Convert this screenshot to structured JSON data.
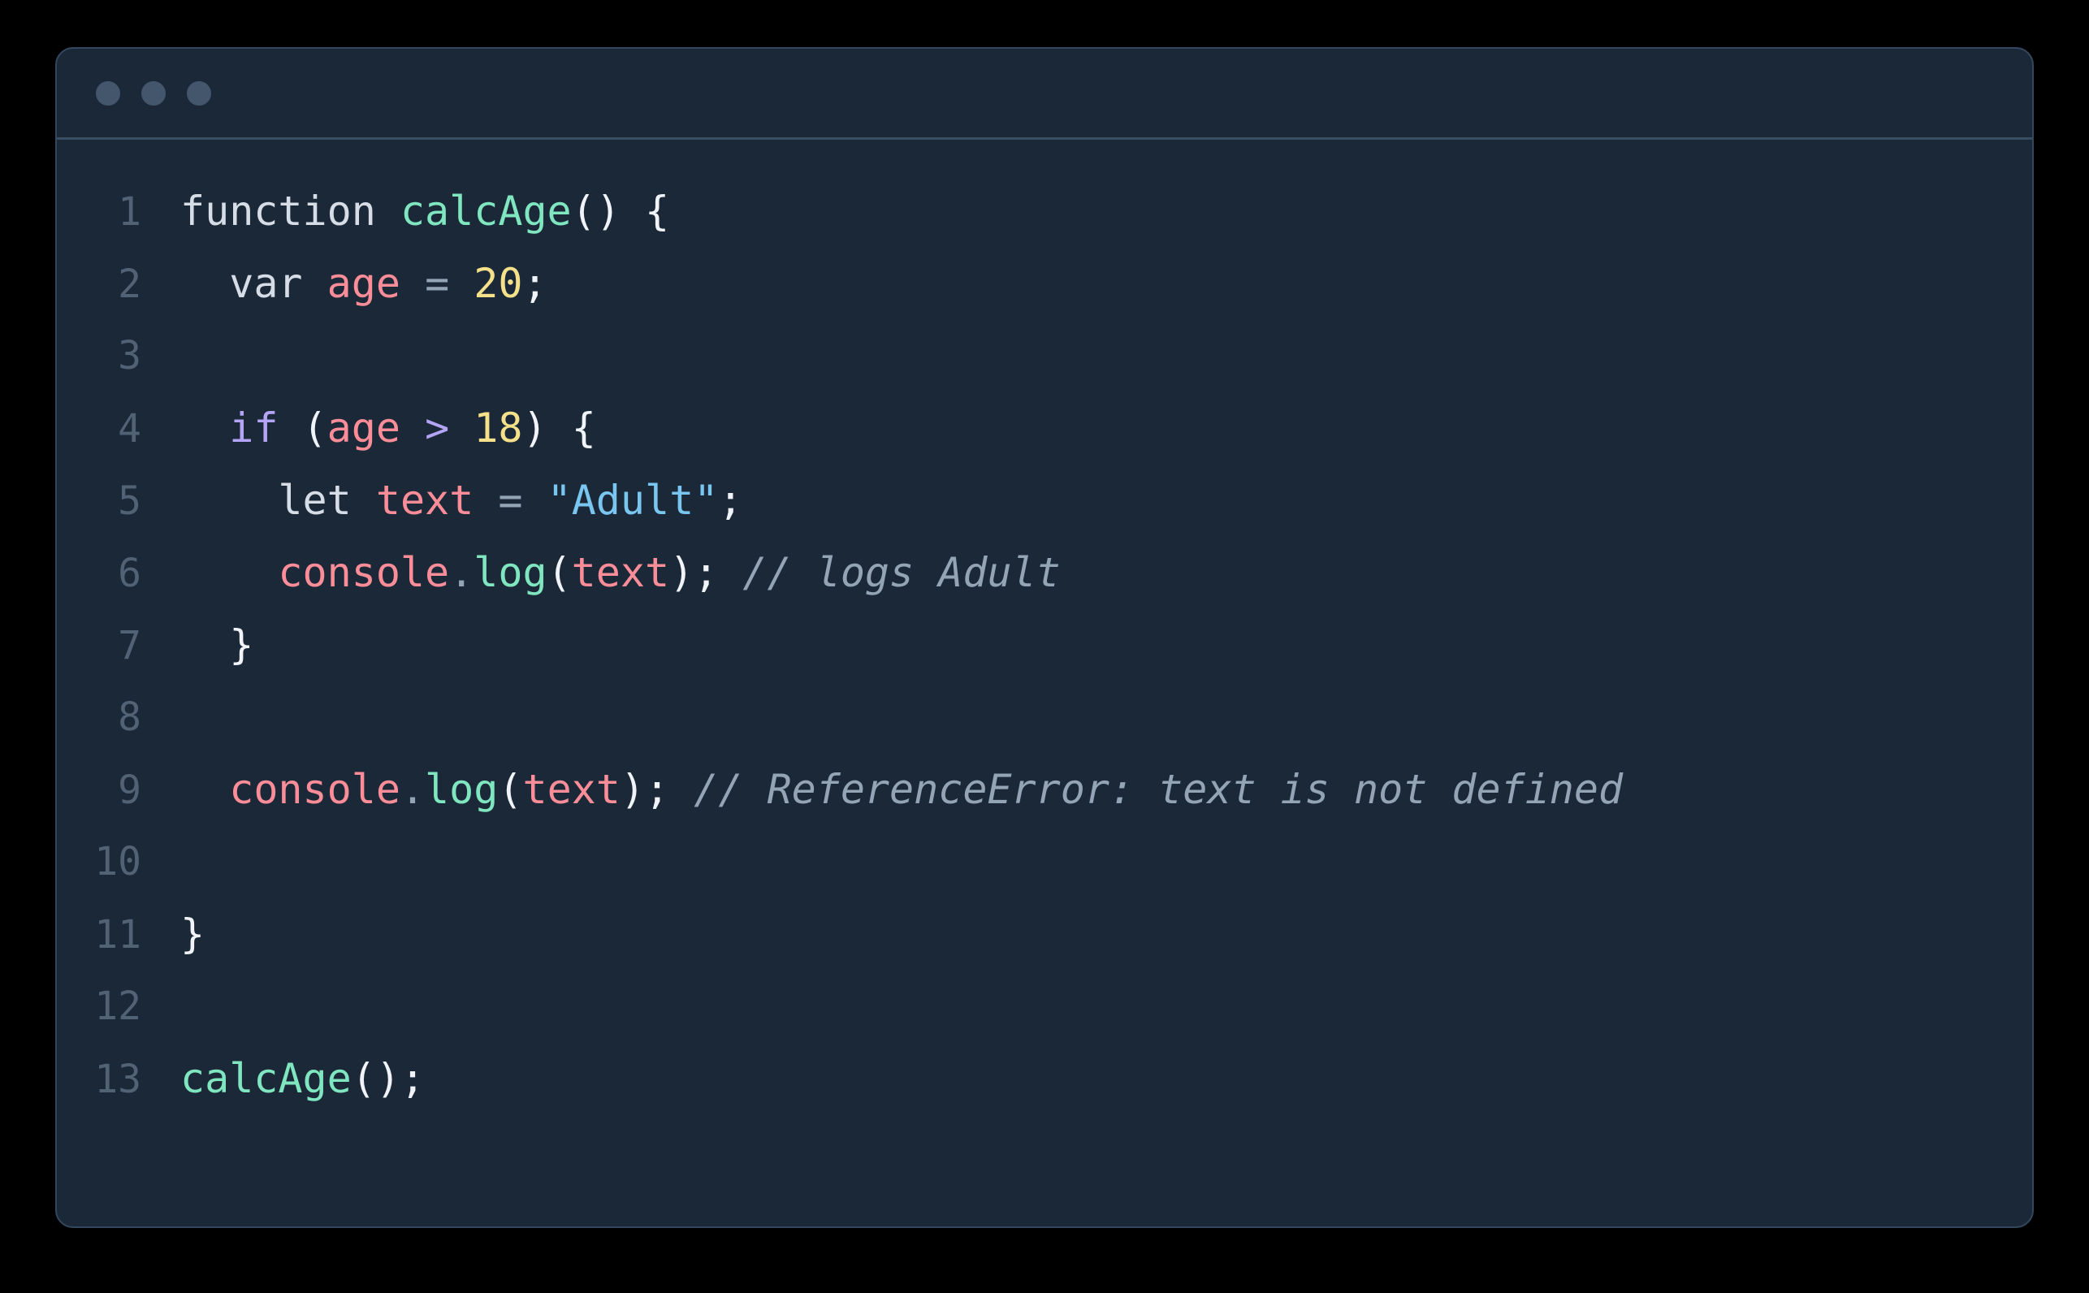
{
  "window": {
    "background_color": "#1b2838",
    "border_color": "#33485e",
    "page_background": "#000000",
    "titlebar": {
      "dots": [
        {
          "name": "close-dot",
          "color": "#44566c"
        },
        {
          "name": "minimize-dot",
          "color": "#44566c"
        },
        {
          "name": "maximize-dot",
          "color": "#44566c"
        }
      ]
    }
  },
  "editor": {
    "language": "javascript",
    "gutter_color": "#516274",
    "lines": [
      {
        "number": "1",
        "tokens": [
          {
            "t": "function",
            "c": "t-declare"
          },
          {
            "t": " ",
            "c": "t-plain"
          },
          {
            "t": "calcAge",
            "c": "t-func"
          },
          {
            "t": "()",
            "c": "t-punct"
          },
          {
            "t": " ",
            "c": "t-plain"
          },
          {
            "t": "{",
            "c": "t-punct"
          }
        ]
      },
      {
        "number": "2",
        "tokens": [
          {
            "t": "  ",
            "c": "t-plain"
          },
          {
            "t": "var",
            "c": "t-declare"
          },
          {
            "t": " ",
            "c": "t-plain"
          },
          {
            "t": "age",
            "c": "t-var"
          },
          {
            "t": " ",
            "c": "t-plain"
          },
          {
            "t": "=",
            "c": "t-op"
          },
          {
            "t": " ",
            "c": "t-plain"
          },
          {
            "t": "20",
            "c": "t-number"
          },
          {
            "t": ";",
            "c": "t-punct"
          }
        ]
      },
      {
        "number": "3",
        "tokens": []
      },
      {
        "number": "4",
        "tokens": [
          {
            "t": "  ",
            "c": "t-plain"
          },
          {
            "t": "if",
            "c": "t-keyword"
          },
          {
            "t": " ",
            "c": "t-plain"
          },
          {
            "t": "(",
            "c": "t-punct"
          },
          {
            "t": "age",
            "c": "t-var"
          },
          {
            "t": " ",
            "c": "t-plain"
          },
          {
            "t": ">",
            "c": "t-keyword"
          },
          {
            "t": " ",
            "c": "t-plain"
          },
          {
            "t": "18",
            "c": "t-number"
          },
          {
            "t": ")",
            "c": "t-punct"
          },
          {
            "t": " ",
            "c": "t-plain"
          },
          {
            "t": "{",
            "c": "t-punct"
          }
        ]
      },
      {
        "number": "5",
        "tokens": [
          {
            "t": "    ",
            "c": "t-plain"
          },
          {
            "t": "let",
            "c": "t-declare"
          },
          {
            "t": " ",
            "c": "t-plain"
          },
          {
            "t": "text",
            "c": "t-var"
          },
          {
            "t": " ",
            "c": "t-plain"
          },
          {
            "t": "=",
            "c": "t-op"
          },
          {
            "t": " ",
            "c": "t-plain"
          },
          {
            "t": "\"Adult\"",
            "c": "t-string"
          },
          {
            "t": ";",
            "c": "t-punct"
          }
        ]
      },
      {
        "number": "6",
        "tokens": [
          {
            "t": "    ",
            "c": "t-plain"
          },
          {
            "t": "console",
            "c": "t-var"
          },
          {
            "t": ".",
            "c": "t-dot"
          },
          {
            "t": "log",
            "c": "t-func"
          },
          {
            "t": "(",
            "c": "t-punct"
          },
          {
            "t": "text",
            "c": "t-var"
          },
          {
            "t": ")",
            "c": "t-punct"
          },
          {
            "t": ";",
            "c": "t-punct"
          },
          {
            "t": " ",
            "c": "t-plain"
          },
          {
            "t": "// logs Adult",
            "c": "t-comment"
          }
        ]
      },
      {
        "number": "7",
        "tokens": [
          {
            "t": "  ",
            "c": "t-plain"
          },
          {
            "t": "}",
            "c": "t-punct"
          }
        ]
      },
      {
        "number": "8",
        "tokens": []
      },
      {
        "number": "9",
        "tokens": [
          {
            "t": "  ",
            "c": "t-plain"
          },
          {
            "t": "console",
            "c": "t-var"
          },
          {
            "t": ".",
            "c": "t-dot"
          },
          {
            "t": "log",
            "c": "t-func"
          },
          {
            "t": "(",
            "c": "t-punct"
          },
          {
            "t": "text",
            "c": "t-var"
          },
          {
            "t": ")",
            "c": "t-punct"
          },
          {
            "t": ";",
            "c": "t-punct"
          },
          {
            "t": " ",
            "c": "t-plain"
          },
          {
            "t": "// ReferenceError: text is not defined",
            "c": "t-comment"
          }
        ]
      },
      {
        "number": "10",
        "tokens": []
      },
      {
        "number": "11",
        "tokens": [
          {
            "t": "}",
            "c": "t-punct"
          }
        ]
      },
      {
        "number": "12",
        "tokens": []
      },
      {
        "number": "13",
        "tokens": [
          {
            "t": "calcAge",
            "c": "t-func"
          },
          {
            "t": "()",
            "c": "t-punct"
          },
          {
            "t": ";",
            "c": "t-punct"
          }
        ]
      }
    ]
  }
}
